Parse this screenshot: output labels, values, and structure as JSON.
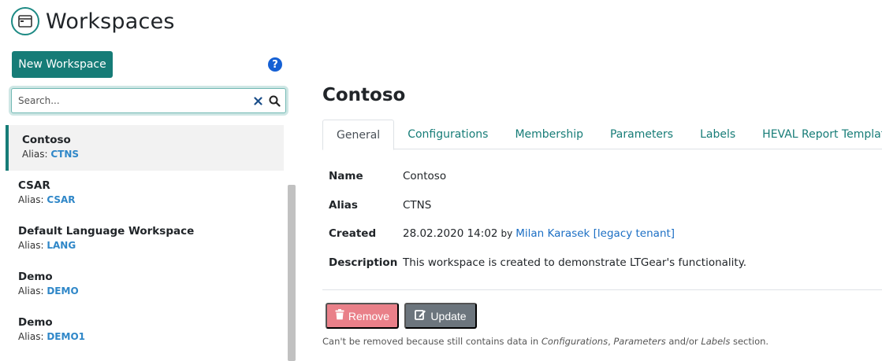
{
  "header": {
    "title": "Workspaces",
    "icon": "window-icon"
  },
  "sidebar": {
    "new_button": "New Workspace",
    "help_icon": "?",
    "search": {
      "placeholder": "Search...",
      "value": ""
    },
    "alias_prefix": "Alias: ",
    "items": [
      {
        "name": "Contoso",
        "alias": "CTNS",
        "active": true
      },
      {
        "name": "CSAR",
        "alias": "CSAR"
      },
      {
        "name": "Default Language Workspace",
        "alias": "LANG"
      },
      {
        "name": "Demo",
        "alias": "DEMO"
      },
      {
        "name": "Demo",
        "alias": "DEMO1"
      }
    ]
  },
  "detail": {
    "title": "Contoso",
    "tabs": [
      "General",
      "Configurations",
      "Membership",
      "Parameters",
      "Labels",
      "HEVAL Report Templates"
    ],
    "fields": {
      "name_label": "Name",
      "name_value": "Contoso",
      "alias_label": "Alias",
      "alias_value": "CTNS",
      "created_label": "Created",
      "created_value": "28.02.2020 14:02",
      "created_by": "by",
      "created_user": "Milan Karasek [legacy tenant]",
      "description_label": "Description",
      "description_value": "This workspace is created to demonstrate LTGear's functionality."
    },
    "remove_label": "Remove",
    "update_label": "Update",
    "note": {
      "prefix": "Can't be removed because still contains data in ",
      "configurations": "Configurations",
      "sep1": ", ",
      "parameters": "Parameters",
      "sep2": " and/or ",
      "labels": "Labels",
      "suffix": " section."
    }
  },
  "colors": {
    "accent": "#167c77",
    "link": "#2f87c8",
    "remove": "#e98089",
    "update": "#6c757d"
  }
}
